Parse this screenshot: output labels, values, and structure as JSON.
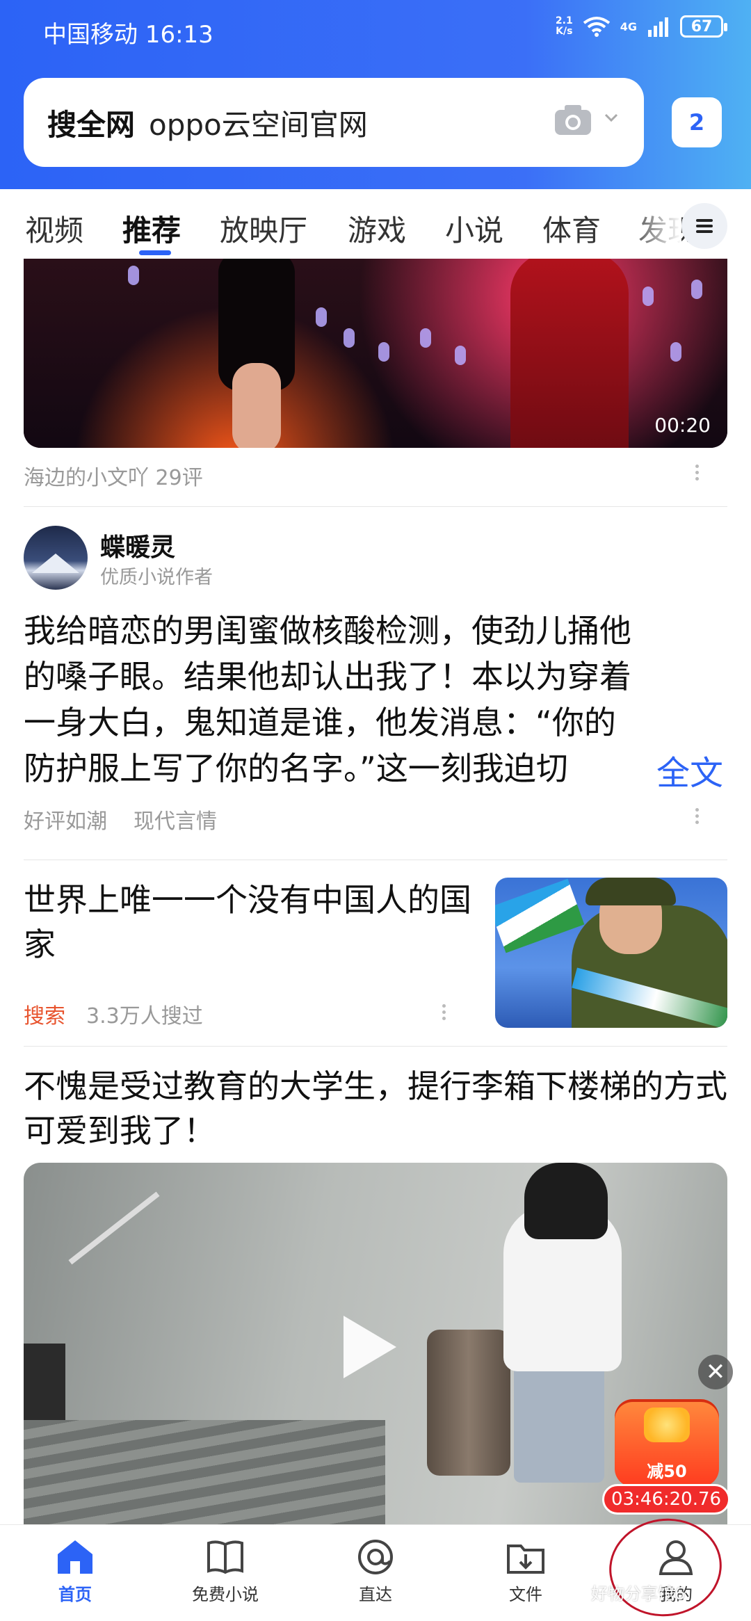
{
  "status_bar": {
    "carrier_time": "中国移动 16:13",
    "net_speed_value": "2.1",
    "net_speed_unit": "K/s",
    "network": "4G",
    "battery": "67"
  },
  "search": {
    "prefix": "搜全网",
    "query": "oppo云空间官网",
    "tab_count": "2"
  },
  "tabs": [
    {
      "label": "视频"
    },
    {
      "label": "推荐"
    },
    {
      "label": "放映厅"
    },
    {
      "label": "游戏"
    },
    {
      "label": "小说"
    },
    {
      "label": "体育"
    },
    {
      "label": "发现"
    }
  ],
  "feed": {
    "video1": {
      "duration": "00:20",
      "meta": "海边的小文吖 29评"
    },
    "novel": {
      "author": "蝶暖灵",
      "author_desc": "优质小说作者",
      "lines": [
        "我给暗恋的男闺蜜做核酸检测，使劲儿捅他",
        "的嗓子眼。结果他却认出我了！本以为穿着",
        "一身大白，鬼知道是谁，他发消息：“你的",
        "防护服上写了你的名字。”这一刻我迫切"
      ],
      "full_text": "全文",
      "tag1": "好评如潮",
      "tag2": "现代言情"
    },
    "search_card": {
      "title": "世界上唯一一个没有中国人的国家",
      "tag": "搜索",
      "count": "3.3万人搜过"
    },
    "video3": {
      "title": "不愧是受过教育的大学生，提行李箱下楼梯的方式可爱到我了！"
    },
    "promo": {
      "label": "减50",
      "countdown": "03:46:20.76",
      "close": "✕"
    }
  },
  "bottom_nav": [
    {
      "label": "首页",
      "icon": "home-icon"
    },
    {
      "label": "免费小说",
      "icon": "book-icon"
    },
    {
      "label": "直达",
      "icon": "direct-icon"
    },
    {
      "label": "文件",
      "icon": "download-folder-icon"
    },
    {
      "label": "我的",
      "icon": "profile-icon"
    }
  ],
  "watermark": "好物分享馆6",
  "colors": {
    "accent": "#2c63f6",
    "search_tag": "#e8542e",
    "promo_red": "#f02b2b"
  }
}
